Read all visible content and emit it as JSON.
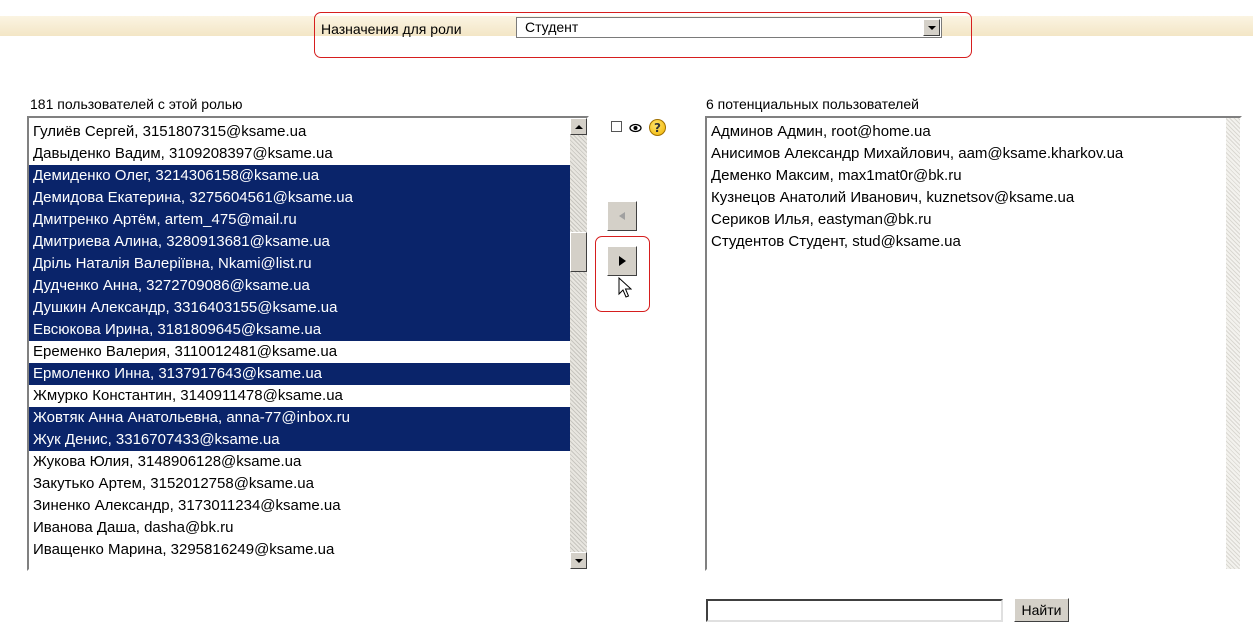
{
  "role_filter": {
    "label": "Назначения для роли",
    "selected": "Студент"
  },
  "assigned": {
    "heading": "181 пользователей с этой ролью",
    "items": [
      {
        "text": "Гулиёв Сергей, 3151807315@ksame.ua",
        "selected": false
      },
      {
        "text": "Давыденко Вадим, 3109208397@ksame.ua",
        "selected": false
      },
      {
        "text": "Демиденко Олег, 3214306158@ksame.ua",
        "selected": true
      },
      {
        "text": "Демидова Екатерина, 3275604561@ksame.ua",
        "selected": true
      },
      {
        "text": "Дмитренко Артём, artem_475@mail.ru",
        "selected": true
      },
      {
        "text": "Дмитриева Алина, 3280913681@ksame.ua",
        "selected": true
      },
      {
        "text": "Дріль Наталія Валеріївна, Nkami@list.ru",
        "selected": true
      },
      {
        "text": "Дудченко Анна, 3272709086@ksame.ua",
        "selected": true
      },
      {
        "text": "Душкин Александр, 3316403155@ksame.ua",
        "selected": true
      },
      {
        "text": "Евсюкова Ирина, 3181809645@ksame.ua",
        "selected": true
      },
      {
        "text": "Еременко Валерия, 3110012481@ksame.ua",
        "selected": false
      },
      {
        "text": "Ермоленко Инна, 3137917643@ksame.ua",
        "selected": true
      },
      {
        "text": "Жмурко Константин, 3140911478@ksame.ua",
        "selected": false
      },
      {
        "text": "Жовтяк Анна Анатольевна, anna-77@inbox.ru",
        "selected": true
      },
      {
        "text": "Жук Денис, 3316707433@ksame.ua",
        "selected": true
      },
      {
        "text": "Жукова Юлия, 3148906128@ksame.ua",
        "selected": false
      },
      {
        "text": "Закутько Артем, 3152012758@ksame.ua",
        "selected": false
      },
      {
        "text": "Зиненко Александр, 3173011234@ksame.ua",
        "selected": false
      },
      {
        "text": "Иванова Даша, dasha@bk.ru",
        "selected": false
      },
      {
        "text": "Иващенко Марина, 3295816249@ksame.ua",
        "selected": false
      }
    ]
  },
  "potential": {
    "heading": "6 потенциальных пользователей",
    "items": [
      "Админов Админ, root@home.ua",
      "Анисимов Александр Михайлович, aam@ksame.kharkov.ua",
      "Деменко Максим, max1mat0r@bk.ru",
      "Кузнецов Анатолий Иванович, kuznetsov@ksame.ua",
      "Сериков Илья, eastyman@bk.ru",
      "Студентов Студент, stud@ksame.ua"
    ]
  },
  "options": {
    "hidden_checked": false,
    "help_glyph": "?"
  },
  "search": {
    "value": "",
    "button_label": "Найти"
  },
  "colors": {
    "selection": "#0a246a",
    "highlight": "#d61e1e"
  }
}
